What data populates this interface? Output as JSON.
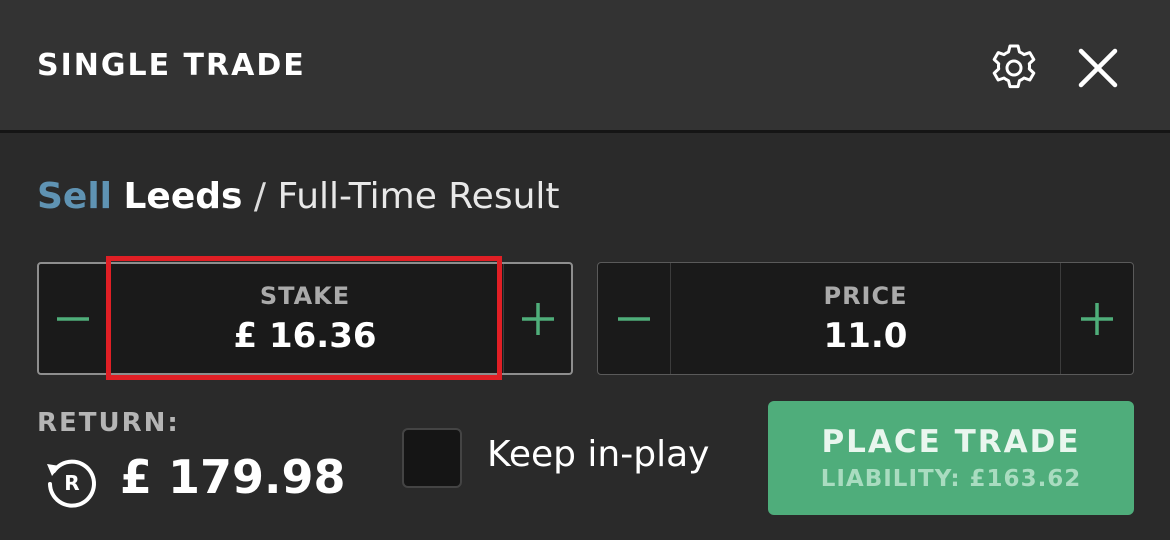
{
  "header": {
    "title": "SINGLE TRADE",
    "settings_icon": "gear-icon",
    "close_icon": "close-icon"
  },
  "market": {
    "side": "Sell",
    "selection": "Leeds",
    "separator": "/",
    "name": "Full-Time Result"
  },
  "stake": {
    "label": "STAKE",
    "value": "£ 16.36"
  },
  "price": {
    "label": "PRICE",
    "value": "11.0"
  },
  "return": {
    "label": "RETURN:",
    "value": "£ 179.98",
    "icon": "return-icon"
  },
  "keep_in_play": {
    "label": "Keep in-play",
    "checked": false
  },
  "place_trade": {
    "label": "PLACE TRADE",
    "liability": "LIABILITY: £163.62"
  },
  "colors": {
    "background": "#2a2a2a",
    "header": "#333333",
    "accent_green": "#4fad7b",
    "sell_blue": "#5f93b3",
    "highlight_red": "#e01f25"
  }
}
